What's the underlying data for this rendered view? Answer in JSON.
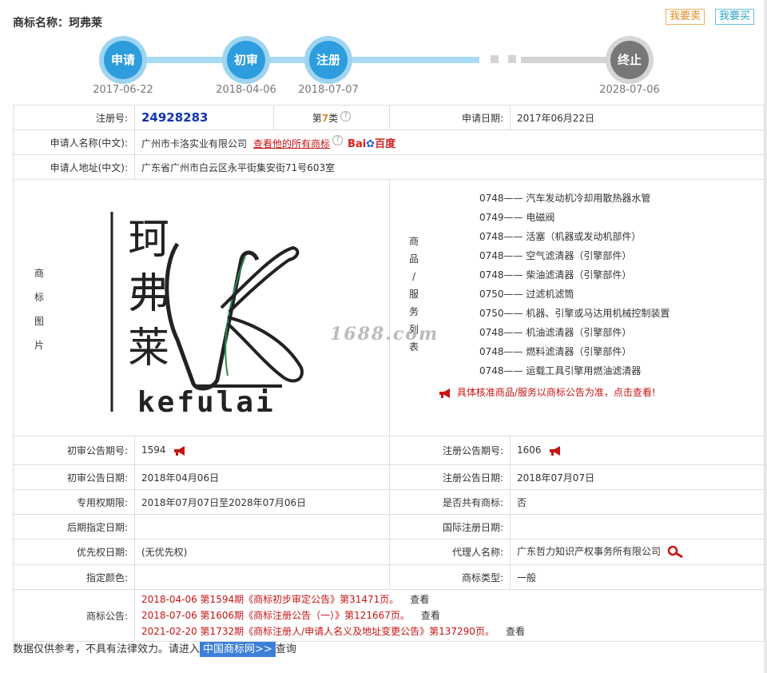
{
  "header": {
    "title": "商标名称：珂弗莱",
    "sell_label": "我要卖",
    "buy_label": "我要买"
  },
  "timeline": {
    "stages": [
      {
        "label": "申请",
        "date": "2017-06-22"
      },
      {
        "label": "初审",
        "date": "2018-04-06"
      },
      {
        "label": "注册",
        "date": "2018-07-07"
      },
      {
        "label": "终止",
        "date": "2028-07-06"
      }
    ]
  },
  "info": {
    "reg_no_label": "注册号:",
    "reg_no": "24928283",
    "class_prefix": "第",
    "class_num": "7",
    "class_suffix": "类",
    "apply_date_label": "申请日期:",
    "apply_date": "2017年06月22日",
    "applicant_name_label": "申请人名称(中文):",
    "applicant_name": "广州市卡洛实业有限公司",
    "all_marks_link": "查看他的所有商标",
    "baidu_part1": "Bai",
    "baidu_part2": "百度",
    "applicant_addr_label": "申请人地址(中文):",
    "applicant_addr": "广东省广州市白云区永平街集安街71号603室",
    "image_label_chars": [
      "商",
      "标",
      "图",
      "片"
    ],
    "goods_label_chars": [
      "商",
      "品",
      "/",
      "服",
      "务",
      "列",
      "表"
    ],
    "logo_chars": [
      "珂",
      "弗",
      "莱"
    ],
    "logo_latin": "kefulai",
    "watermark": "1688.com",
    "goods": [
      {
        "code": "0748",
        "name": "汽车发动机冷却用散热器水管"
      },
      {
        "code": "0749",
        "name": "电磁阀"
      },
      {
        "code": "0748",
        "name": "活塞（机器或发动机部件）"
      },
      {
        "code": "0748",
        "name": "空气滤清器（引擎部件）"
      },
      {
        "code": "0748",
        "name": "柴油滤清器（引擎部件）"
      },
      {
        "code": "0750",
        "name": "过滤机滤筒"
      },
      {
        "code": "0750",
        "name": "机器、引擎或马达用机械控制装置"
      },
      {
        "code": "0748",
        "name": "机油滤清器（引擎部件）"
      },
      {
        "code": "0748",
        "name": "燃料滤清器（引擎部件）"
      },
      {
        "code": "0748",
        "name": "运载工具引擎用燃油滤清器"
      }
    ],
    "goods_note": "具体核准商品/服务以商标公告为准，点击查看!",
    "prelim_no_label": "初审公告期号:",
    "prelim_no": "1594",
    "reg_notice_no_label": "注册公告期号:",
    "reg_notice_no": "1606",
    "prelim_date_label": "初审公告日期:",
    "prelim_date": "2018年04月06日",
    "reg_notice_date_label": "注册公告日期:",
    "reg_notice_date": "2018年07月07日",
    "exclusive_label": "专用权期限:",
    "exclusive_period": "2018年07月07日至2028年07月06日",
    "shared_label": "是否共有商标:",
    "shared": "否",
    "later_label": "后期指定日期:",
    "later": "",
    "intl_label": "国际注册日期:",
    "intl": "",
    "priority_label": "优先权日期:",
    "priority": "(无优先权)",
    "agent_label": "代理人名称:",
    "agent": "广东哲力知识产权事务所有限公司",
    "color_label": "指定颜色:",
    "color": "",
    "type_label": "商标类型:",
    "type": "一般",
    "notice_label": "商标公告:",
    "notices": [
      {
        "text": "2018-04-06 第1594期《商标初步审定公告》第31471页。",
        "view": "查看"
      },
      {
        "text": "2018-07-06 第1606期《商标注册公告（一）》第121667页。",
        "view": "查看"
      },
      {
        "text": "2021-02-20 第1732期《商标注册人/申请人名义及地址变更公告》第137290页。",
        "view": "查看"
      }
    ]
  },
  "footer": {
    "text1": "数据仅供参考，不具有法律效力。请进入",
    "link": "中国商标网>>",
    "text2": "查询"
  },
  "colors": {
    "active": "#2d9ddd",
    "end": "#777777",
    "red": "#c81414"
  }
}
